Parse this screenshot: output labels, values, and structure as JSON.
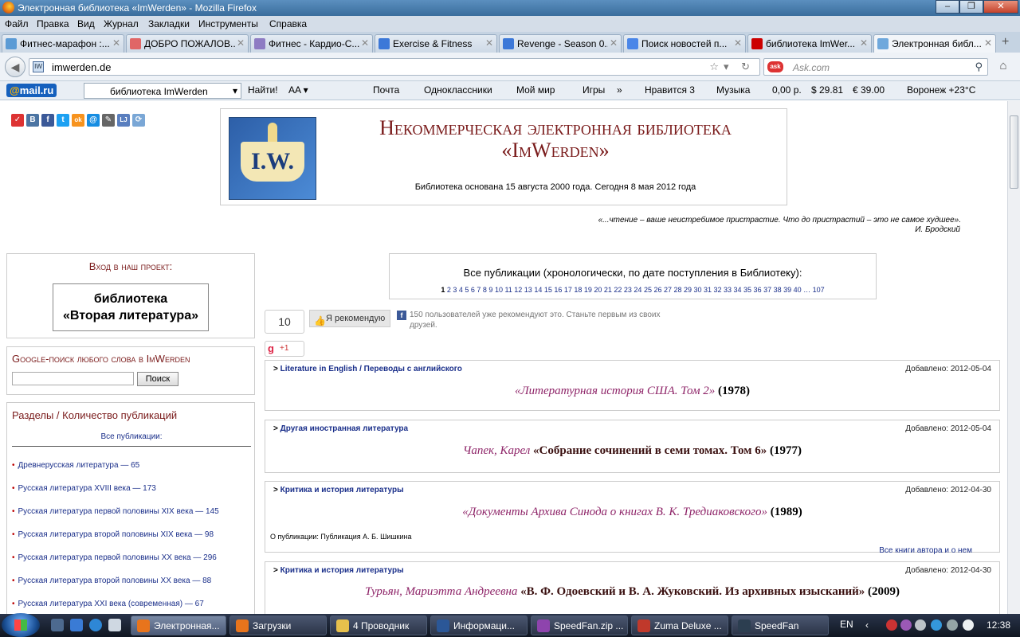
{
  "window": {
    "title": "Электронная библиотека «ImWerden» - Mozilla Firefox",
    "buttons": [
      "‒",
      "❐",
      "✕"
    ]
  },
  "menu": [
    "Файл",
    "Правка",
    "Вид",
    "Журнал",
    "Закладки",
    "Инструменты",
    "Справка"
  ],
  "tabs": [
    {
      "label": "Фитнес-марафон :...",
      "color": "#5b9bd5"
    },
    {
      "label": "ДОБРО ПОЖАЛОВ...",
      "color": "#e06666"
    },
    {
      "label": "Фитнес - Кардио-С...",
      "color": "#8e7cc3"
    },
    {
      "label": "Exercise & Fitness",
      "color": "#3c78d8"
    },
    {
      "label": "Revenge - Season 0...",
      "color": "#3c78d8"
    },
    {
      "label": "Поиск новостей п...",
      "color": "#4a86e8"
    },
    {
      "label": "библиотека ImWer...",
      "color": "#cc0000"
    },
    {
      "label": "Электронная библ...",
      "color": "#6fa8dc"
    }
  ],
  "newtab": "+",
  "nav": {
    "back": "◀",
    "url": "imwerden.de",
    "url_favicon": "IW",
    "url_icons": "☆▾ ↻",
    "search_engine": "ask",
    "search_placeholder": "Ask.com",
    "search_icon": "⚲",
    "home": "⌂"
  },
  "mailbar": {
    "logo_at": "@",
    "logo": "mail.ru",
    "search_text": "библиотека ImWerden",
    "search_dd": "▾",
    "go": "Найти!",
    "font_tool": "AA ▾",
    "items": [
      "Почта",
      "Одноклассники",
      "Мой мир",
      "Игры",
      "»",
      "Нравится 3",
      "Музыка",
      "0,00 р.",
      "$ 29.81",
      "€ 39.00",
      "Воронеж +23°C"
    ]
  },
  "site": {
    "logo_text": "I.W.",
    "title": "Некоммерческая электронная библиотека «ImWerden»",
    "subtitle": "Библиотека основана 15 августа 2000 года. Сегодня 8 мая 2012 года",
    "quote": "«...чтение – ваше неистребимое пристрастие. Что до пристрастий – это не самое худшее».",
    "quote_author": "И. Бродский"
  },
  "social_icons": [
    {
      "name": "vote-icon",
      "color": "#d33",
      "glyph": "✓"
    },
    {
      "name": "vkontakte-icon",
      "color": "#4c75a3",
      "glyph": "В"
    },
    {
      "name": "facebook-icon",
      "color": "#3b5998",
      "glyph": "f"
    },
    {
      "name": "twitter-icon",
      "color": "#1da1f2",
      "glyph": "t"
    },
    {
      "name": "odnoklassniki-icon",
      "color": "#f7931e",
      "glyph": "ok"
    },
    {
      "name": "moimir-icon",
      "color": "#168de2",
      "glyph": "@"
    },
    {
      "name": "bookmark-icon",
      "color": "#666",
      "glyph": "✎"
    },
    {
      "name": "livejournal-icon",
      "color": "#5a7fbf",
      "glyph": "LJ"
    },
    {
      "name": "share-icon",
      "color": "#7aa7d6",
      "glyph": "⟳"
    }
  ],
  "login": {
    "title": "Вход в наш проект:",
    "button_line1": "библиотека",
    "button_line2": "«Вторая литература»"
  },
  "google": {
    "title": "Google-поиск любого слова в ImWerden",
    "button": "Поиск"
  },
  "sections": {
    "title": "Разделы / Количество публикаций",
    "all": "Все публикации:",
    "items": [
      "Древнерусская литература — 65",
      "Русская литература XVIII века — 173",
      "Русская литература первой половины XIX века — 145",
      "Русская литература второй половины XIX века — 98",
      "Русская литература первой половины XX века — 296",
      "Русская литература второй половины XX века — 88",
      "Русская литература XXI века (современная) — 67"
    ]
  },
  "publications": {
    "title": "Все публикации (хронологически, по дате поступления в Библиотеку):",
    "current_page": "1",
    "pages": "2 3 4 5 6 7 8 9 10 11 12 13 14 15 16 17 18 19 20 21 22 23 24 25 26 27 28 29 30 31 32 33 34 35 36 37 38 39 40 … 107"
  },
  "like": {
    "count": "10",
    "button": "Я рекомендую",
    "thumb": "👍",
    "text": "150 пользователей уже рекомендуют это. Станьте первым из своих друзей.",
    "gplus": "+1",
    "gplus_g": "g"
  },
  "entries": [
    {
      "category": "Literature in English / Переводы с английского",
      "date": "Добавлено: 2012-05-04",
      "author": "",
      "title": "«Литературная история США. Том 2»",
      "year": "(1978)"
    },
    {
      "category": "Другая иностранная литература",
      "date": "Добавлено: 2012-05-04",
      "author": "Чапек, Карел",
      "title": "«Собрание сочинений в семи томах. Том 6»",
      "year": "(1977)"
    },
    {
      "category": "Критика и история литературы",
      "date": "Добавлено: 2012-04-30",
      "author": "",
      "title": "«Документы Архива Синода о книгах В. К. Тредиаковского»",
      "year": "(1989)",
      "note": "О публикации: Публикация А. Б. Шишкина",
      "all_books": "Все книги автора и о нем"
    },
    {
      "category": "Критика и история литературы",
      "date": "Добавлено: 2012-04-30",
      "author": "Турьян, Мариэтта Андреевна",
      "title": "«В. Ф. Одоевский и В. А. Жуковский. Из архивных изысканий»",
      "year": "(2009)"
    }
  ],
  "taskbar": {
    "items": [
      {
        "label": "Электронная...",
        "color": "#e8741c",
        "active": true
      },
      {
        "label": "Загрузки",
        "color": "#e8741c",
        "active": false
      },
      {
        "label": "4 Проводник",
        "color": "#e6c04c",
        "active": false
      },
      {
        "label": "Информаци...",
        "color": "#2b5797",
        "active": false
      },
      {
        "label": "SpeedFan.zip ...",
        "color": "#8e44ad",
        "active": false
      },
      {
        "label": "Zuma Deluxe ...",
        "color": "#c0392b",
        "active": false
      },
      {
        "label": "SpeedFan",
        "color": "#2c3e50",
        "active": false
      }
    ],
    "lang": "EN",
    "tray_arrow": "‹",
    "clock": "12:38"
  }
}
